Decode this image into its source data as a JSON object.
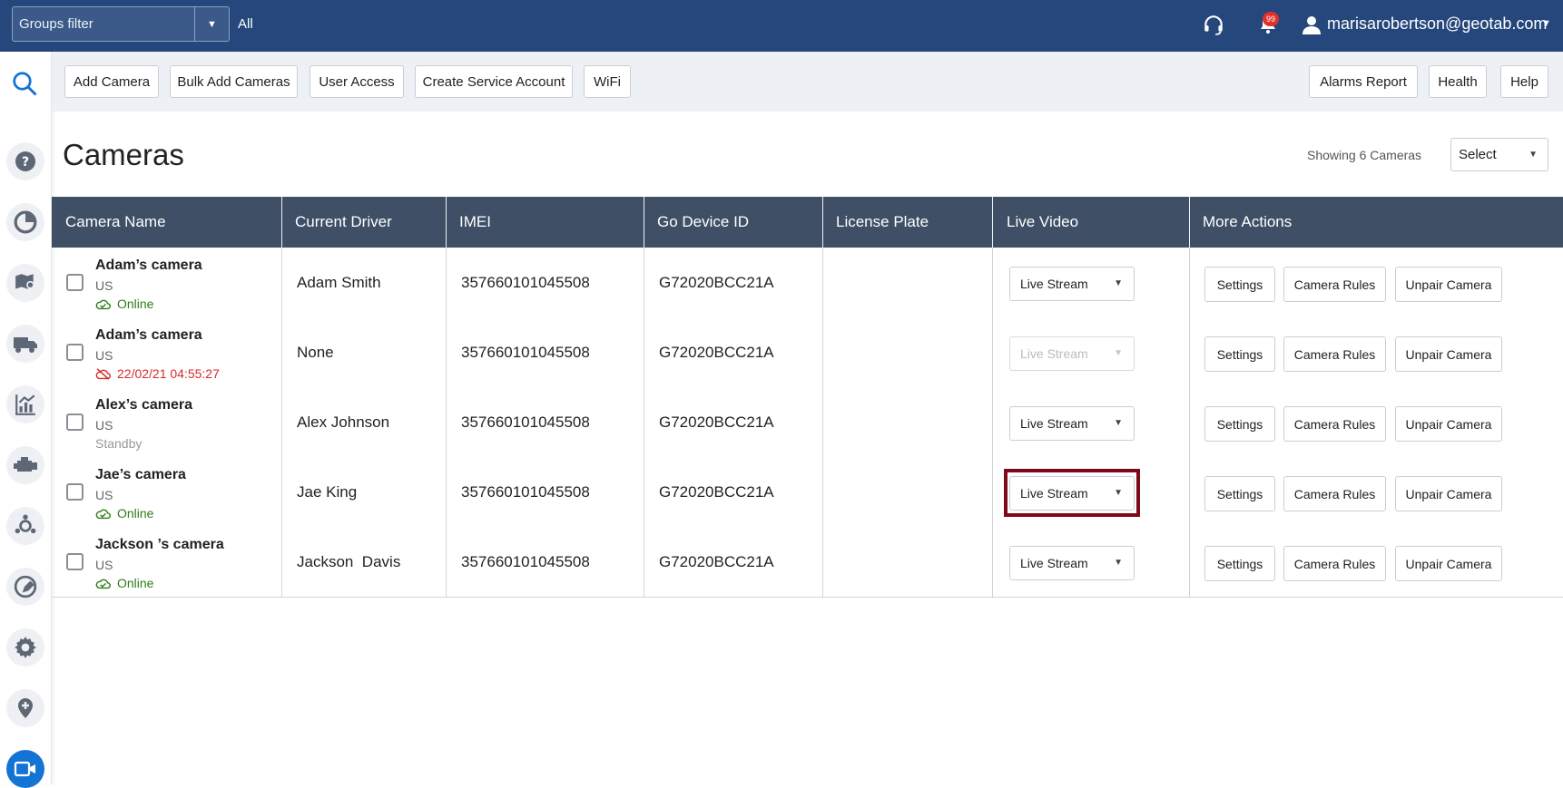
{
  "topbar": {
    "groups_filter": "Groups filter",
    "groups_value": "All",
    "notification_count": "99",
    "user_email": "marisarobertson@geotab.com"
  },
  "toolbar": {
    "add_camera": "Add Camera",
    "bulk_add": "Bulk Add Cameras",
    "user_access": "User Access",
    "create_service_account": "Create Service Account",
    "wifi": "WiFi",
    "alarms_report": "Alarms Report",
    "health": "Health",
    "help": "Help"
  },
  "page": {
    "title": "Cameras",
    "showing": "Showing 6 Cameras",
    "select": "Select"
  },
  "table": {
    "headers": [
      "Camera Name",
      "Current Driver",
      "IMEI",
      "Go Device ID",
      "License Plate",
      "Live Video",
      "More Actions"
    ],
    "rows": [
      {
        "name": "Adam’s camera",
        "region": "US",
        "status": "Online",
        "driver": "Adam Smith",
        "imei": "357660101045508",
        "go_id": "G72020BCC21A",
        "plate": "",
        "live": "Live Stream"
      },
      {
        "name": "Adam’s camera",
        "region": "US",
        "status": "22/02/21 04:55:27",
        "driver": "None",
        "imei": "357660101045508",
        "go_id": "G72020BCC21A",
        "plate": "",
        "live": "Live Stream"
      },
      {
        "name": "Alex’s camera",
        "region": "US",
        "status": "Standby",
        "driver": "Alex Johnson",
        "imei": "357660101045508",
        "go_id": "G72020BCC21A",
        "plate": "",
        "live": "Live Stream"
      },
      {
        "name": "Jae’s camera",
        "region": "US",
        "status": "Online",
        "driver": "Jae King",
        "imei": "357660101045508",
        "go_id": "G72020BCC21A",
        "plate": "",
        "live": "Live Stream"
      },
      {
        "name": "Jackson ’s camera",
        "region": "US",
        "status": "Online",
        "driver": "Jackson  Davis",
        "imei": "357660101045508",
        "go_id": "G72020BCC21A",
        "plate": "",
        "live": "Live Stream"
      }
    ],
    "actions": {
      "settings": "Settings",
      "camera_rules": "Camera Rules",
      "unpair": "Unpair Camera"
    }
  },
  "colors": {
    "header_bg": "#25477b",
    "table_head": "#3e4f66",
    "online": "#2e7d19",
    "offline": "#d62b2b",
    "active_nav": "#1474d4",
    "highlight": "#7d0a1a"
  },
  "sidebar_icons": [
    "search-icon",
    "help-icon",
    "dashboard-icon",
    "map-icon",
    "truck-icon",
    "reports-icon",
    "engine-icon",
    "rules-icon",
    "zones-icon",
    "settings-icon",
    "marketplace-icon",
    "camera-icon"
  ]
}
